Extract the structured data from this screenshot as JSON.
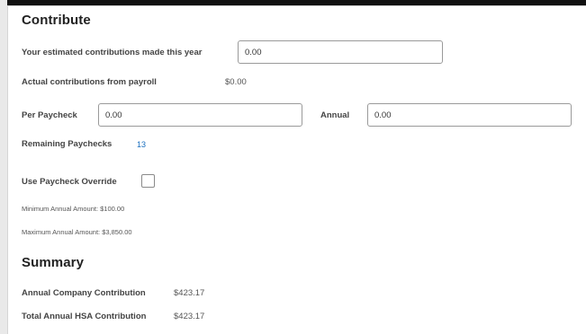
{
  "contribute": {
    "title": "Contribute",
    "estimated_label": "Your estimated contributions made this year",
    "estimated_value": "0.00",
    "actual_label": "Actual contributions from payroll",
    "actual_value": "$0.00",
    "per_paycheck_label": "Per Paycheck",
    "per_paycheck_value": "0.00",
    "annual_label": "Annual",
    "annual_value": "0.00",
    "remaining_label": "Remaining Paychecks",
    "remaining_value": "13",
    "override_label": "Use Paycheck Override",
    "override_checked": false,
    "minimum_text": "Minimum Annual Amount: $100.00",
    "maximum_text": "Maximum Annual Amount: $3,850.00"
  },
  "summary": {
    "title": "Summary",
    "company_label": "Annual Company Contribution",
    "company_value": "$423.17",
    "total_label": "Total Annual HSA Contribution",
    "total_value": "$423.17"
  }
}
